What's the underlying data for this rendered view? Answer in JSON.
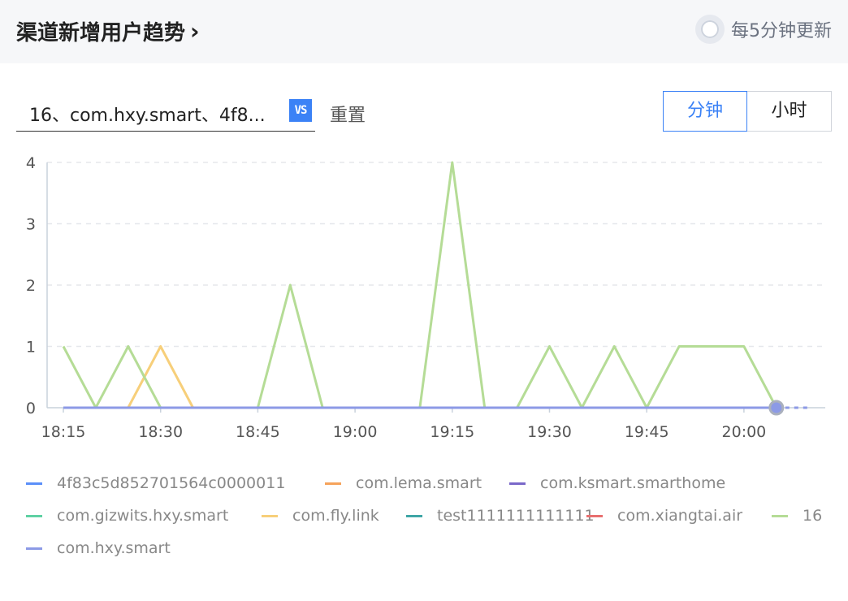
{
  "header": {
    "title": "渠道新增用户趋势",
    "chevron": "›",
    "refresh_label": "每5分钟更新",
    "refresh_icon": "refresh-clock-icon"
  },
  "filter": {
    "value": "16、com.hxy.smart、4f8...",
    "vs_icon_label": "VS",
    "reset_label": "重置"
  },
  "toggle": {
    "minute_label": "分钟",
    "hour_label": "小时",
    "active": "minute"
  },
  "colors": {
    "accent": "#3b82f6",
    "grid": "#e5e7eb",
    "axis": "#c9d2dc"
  },
  "chart_data": {
    "type": "line",
    "x": [
      "18:15",
      "18:20",
      "18:25",
      "18:30",
      "18:35",
      "18:40",
      "18:45",
      "18:50",
      "18:55",
      "19:00",
      "19:05",
      "19:10",
      "19:15",
      "19:20",
      "19:25",
      "19:30",
      "19:35",
      "19:40",
      "19:45",
      "19:50",
      "19:55",
      "20:00",
      "20:05"
    ],
    "x_tick_labels": [
      "18:15",
      "18:30",
      "18:45",
      "19:00",
      "19:15",
      "19:30",
      "19:45",
      "20:00"
    ],
    "ylim": [
      0,
      4
    ],
    "y_ticks": [
      0,
      1,
      2,
      3,
      4
    ],
    "grid": true,
    "legend_position": "bottom",
    "series": [
      {
        "name": "4f83c5d852701564c0000011",
        "color": "#5b8ff9",
        "values": [
          0,
          0,
          0,
          0,
          0,
          0,
          0,
          0,
          0,
          0,
          0,
          0,
          0,
          0,
          0,
          0,
          0,
          0,
          0,
          0,
          0,
          0,
          0
        ]
      },
      {
        "name": "com.lema.smart",
        "color": "#f6a35b",
        "values": [
          0,
          0,
          0,
          0,
          0,
          0,
          0,
          0,
          0,
          0,
          0,
          0,
          0,
          0,
          0,
          0,
          0,
          0,
          0,
          0,
          0,
          0,
          0
        ]
      },
      {
        "name": "com.ksmart.smarthome",
        "color": "#7a68c9",
        "values": [
          0,
          0,
          0,
          0,
          0,
          0,
          0,
          0,
          0,
          0,
          0,
          0,
          0,
          0,
          0,
          0,
          0,
          0,
          0,
          0,
          0,
          0,
          0
        ]
      },
      {
        "name": "com.gizwits.hxy.smart",
        "color": "#5fd1a3",
        "values": [
          0,
          0,
          0,
          0,
          0,
          0,
          0,
          0,
          0,
          0,
          0,
          0,
          0,
          0,
          0,
          0,
          0,
          0,
          0,
          0,
          0,
          0,
          0
        ]
      },
      {
        "name": "com.fly.link",
        "color": "#f7cf7a",
        "values": [
          0,
          0,
          0,
          0,
          0,
          0,
          0,
          0,
          0,
          0,
          0,
          0,
          0,
          0,
          0,
          0,
          0,
          0,
          0,
          0,
          0,
          0,
          0
        ],
        "nonzero": [
          [
            2,
            0
          ],
          [
            3,
            1
          ],
          [
            4,
            0
          ]
        ]
      },
      {
        "name": "test1111111111111",
        "color": "#3fa6a6",
        "values": [
          0,
          0,
          0,
          0,
          0,
          0,
          0,
          0,
          0,
          0,
          0,
          0,
          0,
          0,
          0,
          0,
          0,
          0,
          0,
          0,
          0,
          0,
          0
        ]
      },
      {
        "name": "com.xiangtai.air",
        "color": "#e86f6f",
        "values": [
          0,
          0,
          0,
          0,
          0,
          0,
          0,
          0,
          0,
          0,
          0,
          0,
          0,
          0,
          0,
          0,
          0,
          0,
          0,
          0,
          0,
          0,
          0
        ]
      },
      {
        "name": "16",
        "color": "#b5dc96",
        "values": [
          1,
          0,
          1,
          0,
          0,
          0,
          0,
          2,
          0,
          0,
          0,
          0,
          4,
          0,
          0,
          1,
          0,
          1,
          0,
          1,
          1,
          1,
          0
        ]
      },
      {
        "name": "com.hxy.smart",
        "color": "#8c9ae6",
        "values": [
          0,
          0,
          0,
          0,
          0,
          0,
          0,
          0,
          0,
          0,
          0,
          0,
          0,
          0,
          0,
          0,
          0,
          0,
          0,
          0,
          0,
          0,
          0
        ]
      }
    ]
  }
}
